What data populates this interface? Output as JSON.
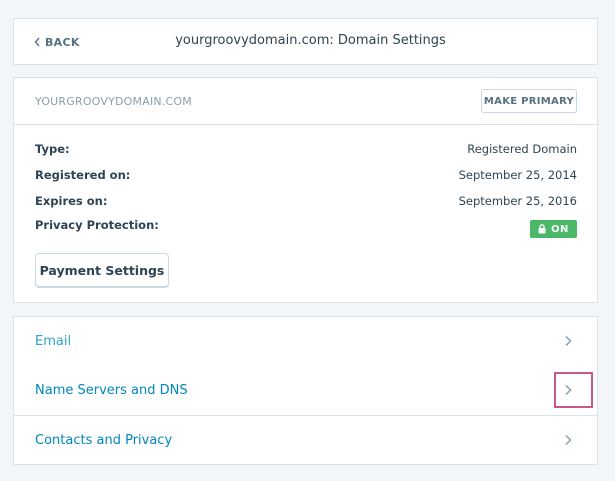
{
  "header": {
    "back_label": "BACK",
    "title": "yourgroovydomain.com: Domain Settings"
  },
  "domain": {
    "name": "YOURGROOVYDOMAIN.COM",
    "make_primary_label": "MAKE PRIMARY",
    "rows": [
      {
        "label": "Type:",
        "value": "Registered Domain"
      },
      {
        "label": "Registered on:",
        "value": "September 25, 2014"
      },
      {
        "label": "Expires on:",
        "value": "September 25, 2016"
      },
      {
        "label": "Privacy Protection:",
        "value": "ON"
      }
    ],
    "privacy_status_color": "#4ab866",
    "payment_settings_label": "Payment Settings"
  },
  "nav": {
    "items": [
      {
        "label": "Email",
        "icon": "chevron-right-icon"
      },
      {
        "label": "Name Servers and DNS",
        "icon": "chevron-right-icon",
        "highlighted": true
      },
      {
        "label": "Contacts and Privacy",
        "icon": "chevron-right-icon"
      }
    ],
    "highlight_color": "#c8588a",
    "link_color": "#0087be"
  }
}
